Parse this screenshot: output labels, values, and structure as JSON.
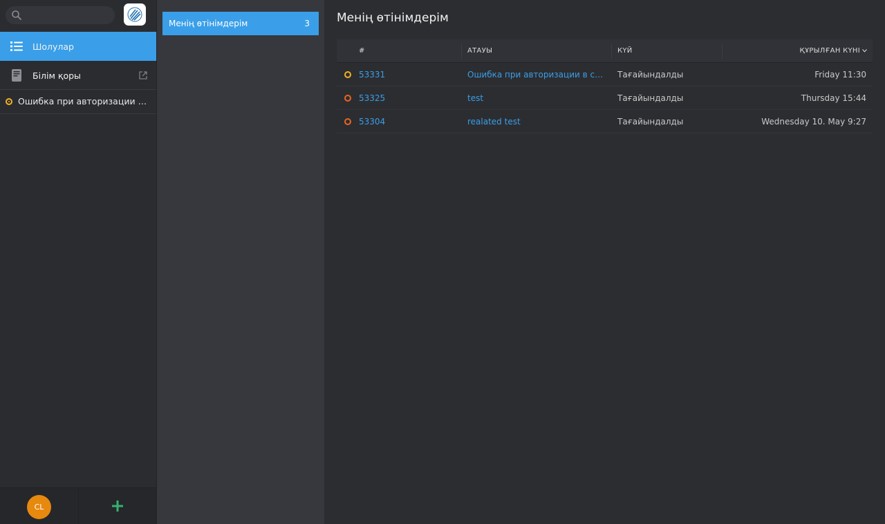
{
  "sidebar": {
    "search": {
      "placeholder": "",
      "value": ""
    },
    "nav": [
      {
        "label": "Шолулар",
        "icon": "list-icon",
        "active": true
      },
      {
        "label": "Білім қоры",
        "icon": "book-icon",
        "active": false,
        "external_icon": "external-link-icon"
      }
    ],
    "open_ticket": {
      "label": "Ошибка при авторизации в си…",
      "status_color": "#f1b421"
    },
    "footer": {
      "avatar_initials": "CL",
      "avatar_color": "#e7890f",
      "add_icon": "plus-icon"
    }
  },
  "overviews": [
    {
      "label": "Менің өтінімдерім",
      "count": "3",
      "active": true
    }
  ],
  "main": {
    "title": "Менің өтінімдерім",
    "columns": {
      "number": "#",
      "title": "АТАУЫ",
      "state": "КҮЙ",
      "created": "ҚҰРЫЛҒАН КҮНІ"
    },
    "rows": [
      {
        "number": "53331",
        "title": "Ошибка при авторизации в сист…",
        "state": "Тағайындалды",
        "created": "Friday 11:30",
        "status": "pending"
      },
      {
        "number": "53325",
        "title": "test",
        "state": "Тағайындалды",
        "created": "Thursday 15:44",
        "status": "escalated"
      },
      {
        "number": "53304",
        "title": "realated test",
        "state": "Тағайындалды",
        "created": "Wednesday 10. May 9:27",
        "status": "escalated"
      }
    ]
  },
  "colors": {
    "accent": "#3a9fe8",
    "pending": "#f1b421",
    "escalated": "#e9661f",
    "add": "#35b26e"
  }
}
